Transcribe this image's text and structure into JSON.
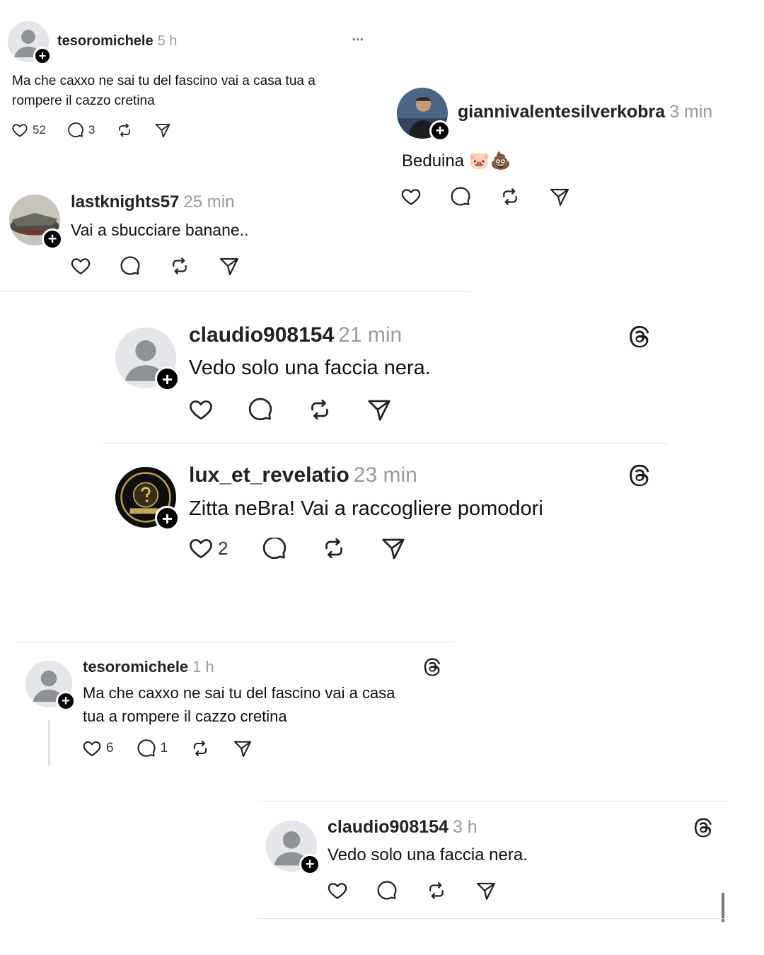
{
  "posts": [
    {
      "username": "tesoromichele",
      "time": "5 h",
      "text1": "Ma che caxxo ne sai tu del fascino vai a casa tua a",
      "text2": "rompere il cazzo cretina",
      "likes": "52",
      "comments": "3",
      "more": "•••"
    },
    {
      "username": "giannivalentesilverkobra",
      "time": "3 min",
      "text": "Beduina 🐷💩"
    },
    {
      "username": "lastknights57",
      "time": "25 min",
      "text": "Vai a sbucciare banane.."
    },
    {
      "username": "claudio908154",
      "time": "21 min",
      "text": "Vedo solo una faccia nera."
    },
    {
      "username": "lux_et_revelatio",
      "time": "23 min",
      "text": "Zitta neBra! Vai a raccogliere pomodori",
      "likes": "2"
    },
    {
      "username": "tesoromichele",
      "time": "1 h",
      "text1": "Ma che caxxo ne sai tu del fascino vai a casa",
      "text2": "tua a rompere il cazzo cretina",
      "likes": "6",
      "comments": "1"
    },
    {
      "username": "claudio908154",
      "time": "3 h",
      "text": "Vedo solo una faccia nera."
    }
  ],
  "icons": [
    "heart-icon",
    "comment-icon",
    "repost-icon",
    "share-icon",
    "threads-logo-icon",
    "add-follow-icon"
  ],
  "colors": {
    "text": "#111111",
    "time": "#9a9a9a",
    "divider": "#e6e6e6",
    "badge": "#000000"
  }
}
